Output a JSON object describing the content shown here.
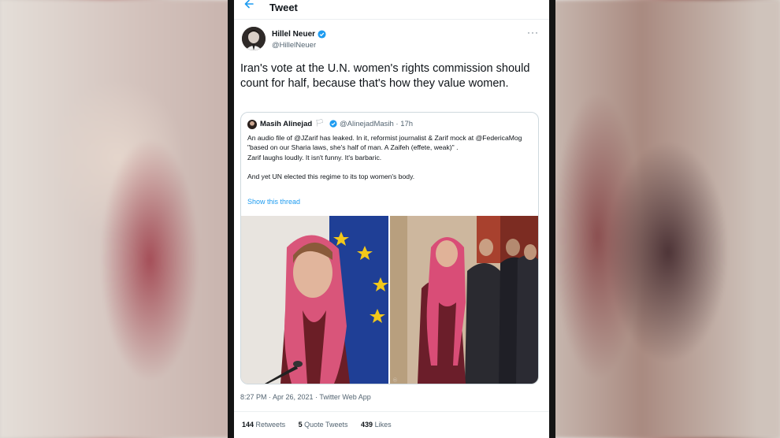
{
  "header": {
    "title": "Tweet",
    "back_icon": "arrow-left-icon"
  },
  "tweet": {
    "author_name": "Hillel Neuer",
    "author_handle": "@HillelNeuer",
    "text": "Iran's vote at the U.N. women's rights commission should count for half, because that's how they value women.",
    "timestamp": "8:27 PM · Apr 26, 2021 · Twitter Web App"
  },
  "quote": {
    "author_name": "Masih Alinejad",
    "flag": "🏳",
    "author_handle": "@AlinejadMasih · 17h",
    "lines": [
      "An audio file of @JZarif has leaked. In it, reformist journalist & Zarif mock at @FedericaMog \"based on our Sharia laws, she's half of man. A Zaifeh (effete, weak)\" .",
      "Zarif laughs loudly. It isn't funny. It's barbaric."
    ],
    "line_after_gap": "And yet UN elected this regime to its top women's body.",
    "show_thread": "Show this thread"
  },
  "stats": {
    "retweets_count": "144",
    "retweets_label": "Retweets",
    "quotes_count": "5",
    "quotes_label": "Quote Tweets",
    "likes_count": "439",
    "likes_label": "Likes"
  },
  "colors": {
    "accent": "#1d9bf0",
    "verified": "#1d9bf0"
  }
}
